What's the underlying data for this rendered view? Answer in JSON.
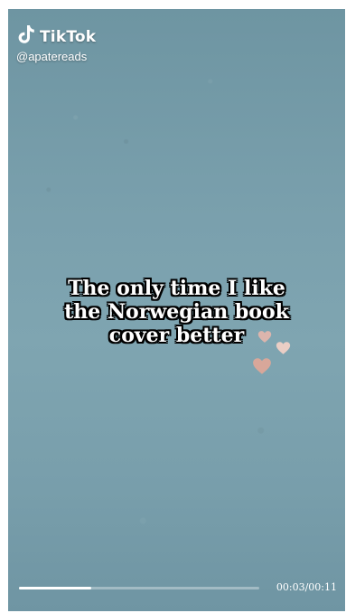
{
  "brand": {
    "name": "TikTok",
    "logo_icon": "tiktok-note-icon"
  },
  "handle": "@apatereads",
  "caption": {
    "lines": [
      "The only time I like",
      "the Norwegian book",
      "cover better"
    ]
  },
  "decorations": {
    "heart_color": "#e7b7ad",
    "icon": "heart-icon"
  },
  "player": {
    "progress": 0.3,
    "time": "00:03/00:11"
  },
  "colors": {
    "background": "#7aa0ad",
    "text": "#ffffff"
  }
}
